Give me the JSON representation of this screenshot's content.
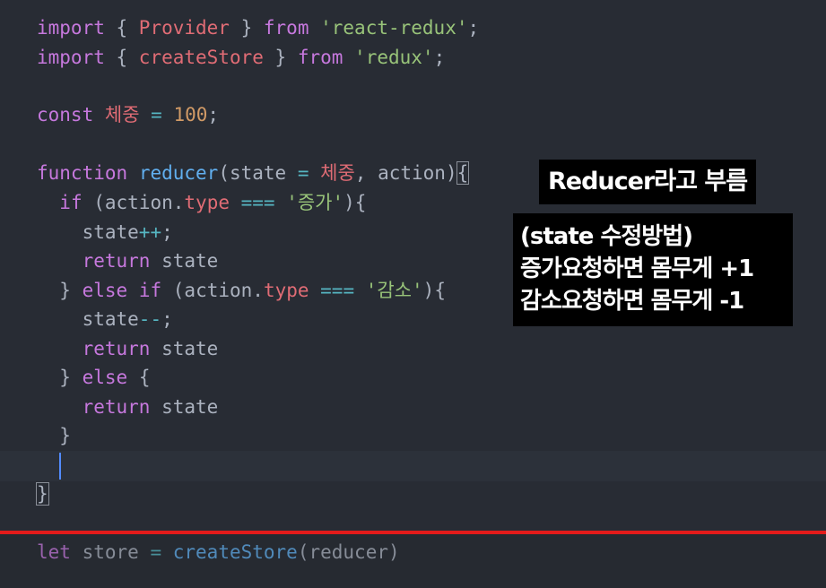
{
  "editor": {
    "line1": {
      "kw1": "import",
      "open": " { ",
      "name": "Provider",
      "close": " } ",
      "from": "from",
      "space": " ",
      "module": "'react-redux'",
      "semi": ";"
    },
    "line2": {
      "kw1": "import",
      "open": " { ",
      "name": "createStore",
      "close": " } ",
      "from": "from",
      "space": " ",
      "module": "'redux'",
      "semi": ";"
    },
    "line3": {
      "kw": "const",
      "space": " ",
      "name": "체중",
      "eq": " = ",
      "value": "100",
      "semi": ";"
    },
    "line4": {
      "kw": "function",
      "space": " ",
      "name": "reducer",
      "open": "(",
      "p1": "state",
      "eq": " = ",
      "def": "체중",
      "comma": ", ",
      "p2": "action",
      "close": ")",
      "brace": "{"
    },
    "line5": {
      "indent": "  ",
      "kw": "if",
      "open": " (",
      "obj": "action",
      "dot": ".",
      "prop": "type",
      "op": " === ",
      "str": "'증가'",
      "close": ")",
      "brace": "{"
    },
    "line6": {
      "indent": "    ",
      "var": "state",
      "op": "++",
      "semi": ";"
    },
    "line7": {
      "indent": "    ",
      "kw": "return",
      "space": " ",
      "var": "state"
    },
    "line8": {
      "indent": "  ",
      "close": "} ",
      "kw1": "else",
      "space": " ",
      "kw2": "if",
      "open": " (",
      "obj": "action",
      "dot": ".",
      "prop": "type",
      "op": " === ",
      "str": "'감소'",
      "paren": ")",
      "brace": "{"
    },
    "line9": {
      "indent": "    ",
      "var": "state",
      "op": "--",
      "semi": ";"
    },
    "line10": {
      "indent": "    ",
      "kw": "return",
      "space": " ",
      "var": "state"
    },
    "line11": {
      "indent": "  ",
      "close": "} ",
      "kw": "else",
      "brace": " {"
    },
    "line12": {
      "indent": "    ",
      "kw": "return",
      "space": " ",
      "var": "state"
    },
    "line13": {
      "indent": "  ",
      "brace": "}"
    },
    "line15": {
      "brace": "}"
    },
    "line16": {
      "kw": "let",
      "space": " ",
      "var": "store",
      "eq": " = ",
      "fn": "createStore",
      "open": "(",
      "arg": "reducer",
      "close": ")"
    }
  },
  "annotations": {
    "label1": "Reducer라고 부름",
    "label2_lines": [
      "(state 수정방법)",
      "증가요청하면 몸무게 +1",
      "감소요청하면 몸무게 -1"
    ]
  },
  "colors": {
    "background": "#282c34",
    "keyword": "#c678dd",
    "function": "#61afef",
    "string": "#98c379",
    "number": "#d19a66",
    "variable": "#e06c75",
    "accent_line": "#e31b1b"
  }
}
